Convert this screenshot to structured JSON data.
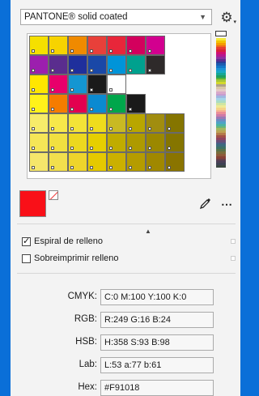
{
  "palette_selector": {
    "name": "PANTONE® solid coated"
  },
  "accent": "#0a6fd8",
  "swatch_grid": {
    "rows": [
      [
        "#f5e000",
        "#f7d300",
        "#f08a00",
        "#e8403a",
        "#e8263a",
        "#d3005d",
        "#d2008f",
        null
      ],
      [
        "#9c1fae",
        "#5a2d8e",
        "#1f2f9c",
        "#1a48a7",
        "#0094d9",
        "#00a18e",
        "#2e2a2a",
        null
      ],
      [
        "#ffe600",
        "#e8006b",
        "#1496d2",
        "#1a1a1a",
        "#ffffff",
        null,
        null,
        null
      ],
      [
        "#fff21a",
        "#f57c00",
        "#e3004f",
        "#0b8ad1",
        "#00a64b",
        "#1a1a1a",
        null,
        null
      ],
      [
        "#f7ec6a",
        "#f7e84a",
        "#f3e337",
        "#efdc1c",
        "#c9b923",
        "#b9a600",
        "#a18d0f",
        "#857500"
      ],
      [
        "#f5e657",
        "#f1e040",
        "#ecd81f",
        "#e6cf00",
        "#c0ac00",
        "#ae9a00",
        "#9b8800",
        "#857500"
      ],
      [
        "#f5e66b",
        "#f2df4d",
        "#eed42b",
        "#e5c900",
        "#cbb000",
        "#b59c00",
        "#a08800",
        "#8a7400"
      ]
    ]
  },
  "color_strip": [
    "#f4ea3a",
    "#f3c300",
    "#f59b00",
    "#ef6a1a",
    "#e73b32",
    "#d8233c",
    "#d11070",
    "#b5178f",
    "#8e2fa0",
    "#5d2d90",
    "#2a3f99",
    "#1d5cb0",
    "#1477c9",
    "#1c93d6",
    "#18a8c5",
    "#15a795",
    "#1e9e62",
    "#54b337",
    "#a4c637",
    "#d3d82c",
    "#b0a189",
    "#d9c7a6",
    "#e4c9c6",
    "#d8a9c9",
    "#c79cd0",
    "#9fb7e0",
    "#a3d4e8",
    "#a9dcc4",
    "#cfe5a2",
    "#eeea94",
    "#f5d287",
    "#f5b492",
    "#ea8e97",
    "#cf7aa7",
    "#9b7ab5",
    "#6c8cc2",
    "#4fa2c7",
    "#4db3a2",
    "#6cb677",
    "#a3b760",
    "#bca354",
    "#b47a4a",
    "#a35147",
    "#8f4460",
    "#6b4e77",
    "#4a5d86",
    "#3c6b7d",
    "#3f7264",
    "#5a7249",
    "#7a6d3c",
    "#8e5b3a",
    "#874237",
    "#6a3f49",
    "#4d3f56",
    "#3e4253",
    "#3b4842"
  ],
  "current_color": "#f91018",
  "options": {
    "fill_spiral": "Espiral de relleno",
    "fill_spiral_checked": true,
    "overprint_fill": "Sobreimprimir relleno",
    "overprint_fill_checked": false
  },
  "values": [
    {
      "label": "CMYK:",
      "value": "C:0 M:100 Y:100 K:0"
    },
    {
      "label": "RGB:",
      "value": "R:249 G:16 B:24"
    },
    {
      "label": "HSB:",
      "value": "H:358 S:93 B:98"
    },
    {
      "label": "Lab:",
      "value": "L:53 a:77 b:61"
    },
    {
      "label": "Hex:",
      "value": "#F91018"
    }
  ]
}
